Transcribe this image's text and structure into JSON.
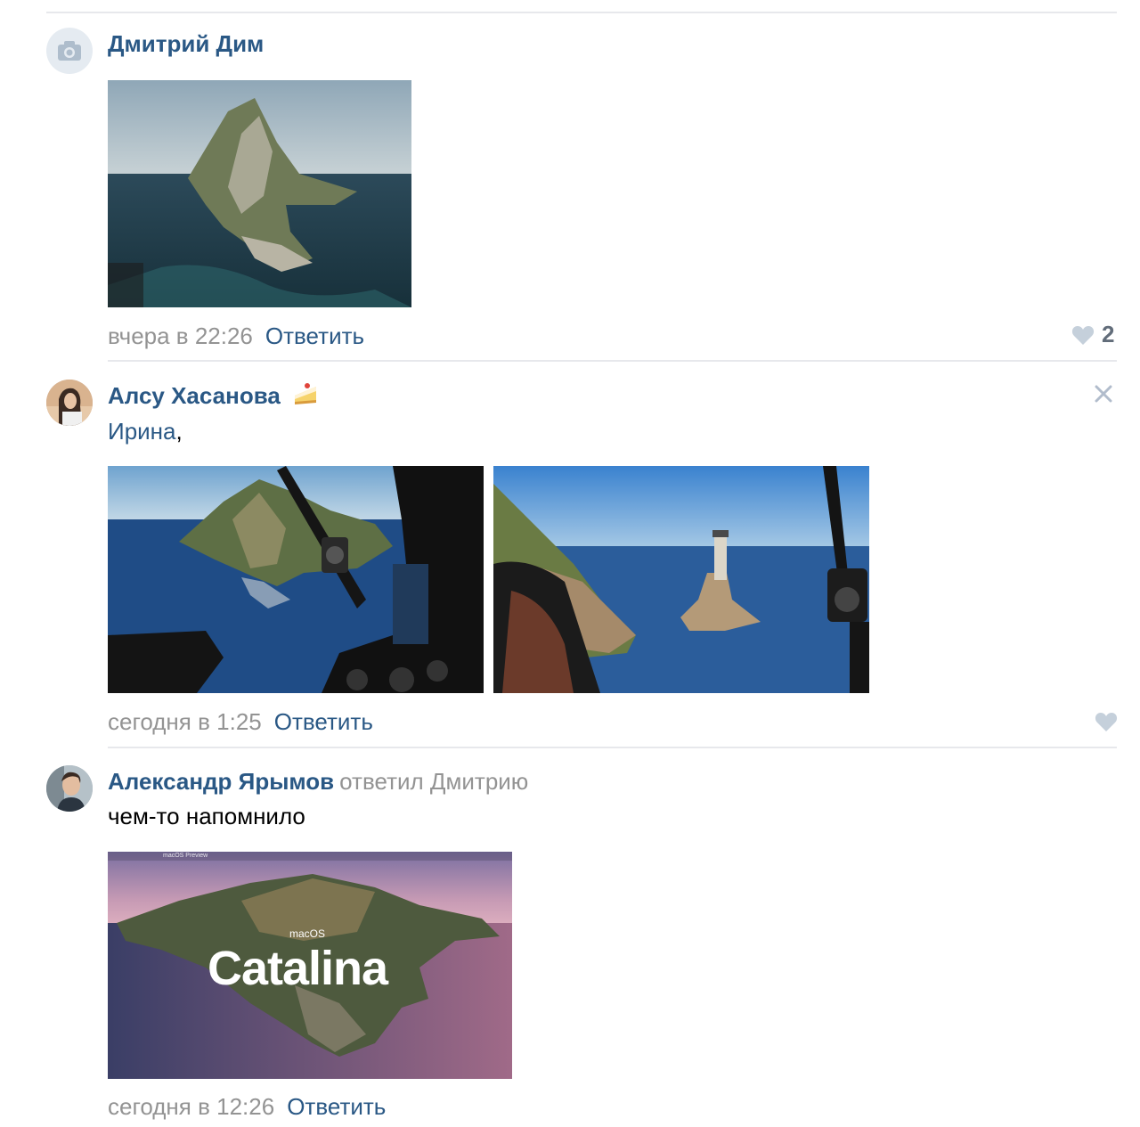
{
  "comments": [
    {
      "author": "Дмитрий Дим",
      "date": "вчера в 22:26",
      "reply_label": "Ответить",
      "likes": "2",
      "avatar_icon": "camera-icon"
    },
    {
      "author": "Алсу Хасанова",
      "author_emoji": "cake-icon",
      "mention": "Ирина",
      "mention_suffix": ",",
      "date": "сегодня в 1:25",
      "reply_label": "Ответить",
      "close_icon": "close-icon"
    },
    {
      "author": "Александр Ярымов",
      "replied_to": "ответил Дмитрию",
      "text": "чем-то напомнило",
      "date": "сегодня в 12:26",
      "reply_label": "Ответить",
      "image_caption_small": "macOS",
      "image_caption_big": "Catalina",
      "image_topbar": "macOS Preview"
    }
  ],
  "colors": {
    "link": "#2a5885",
    "muted": "#939393",
    "separator": "#e7e8ec",
    "like_icon": "#c5d0db"
  }
}
